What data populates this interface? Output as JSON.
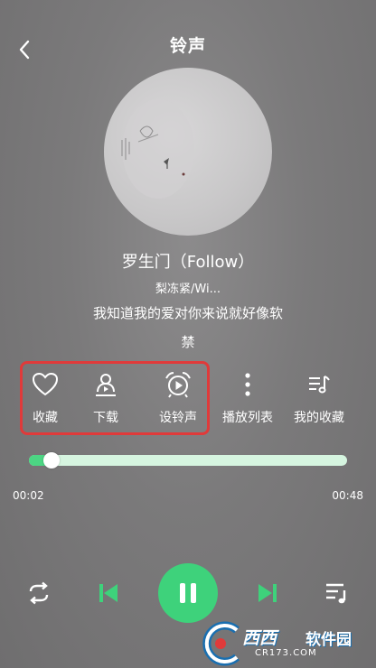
{
  "header": {
    "title": "铃声"
  },
  "song": {
    "title": "罗生门（Follow）",
    "artist": "梨冻紧/Wi...",
    "lyric_line1": "我知道我的爱对你来说就好像软",
    "lyric_line2": "禁"
  },
  "actions": [
    {
      "label": "收藏",
      "icon": "heart-icon"
    },
    {
      "label": "下载",
      "icon": "download-icon"
    },
    {
      "label": "设铃声",
      "icon": "alarm-clock-icon"
    },
    {
      "label": "播放列表",
      "icon": "more-vertical-icon"
    },
    {
      "label": "我的收藏",
      "icon": "music-list-icon"
    }
  ],
  "progress": {
    "current_time": "00:02",
    "total_time": "00:48",
    "fraction": 0.04
  },
  "controls": {
    "loop": "repeat-icon",
    "prev": "skip-previous-icon",
    "play": "pause-icon",
    "next": "skip-next-icon",
    "playlist": "playlist-icon"
  },
  "watermark": {
    "logo_text": "西西",
    "brand_text": "软件园",
    "site_text": "CR173.COM"
  },
  "colors": {
    "accent": "#3ed27b",
    "progress_track": "#d6f5e0",
    "highlight": "#e03a3a"
  }
}
